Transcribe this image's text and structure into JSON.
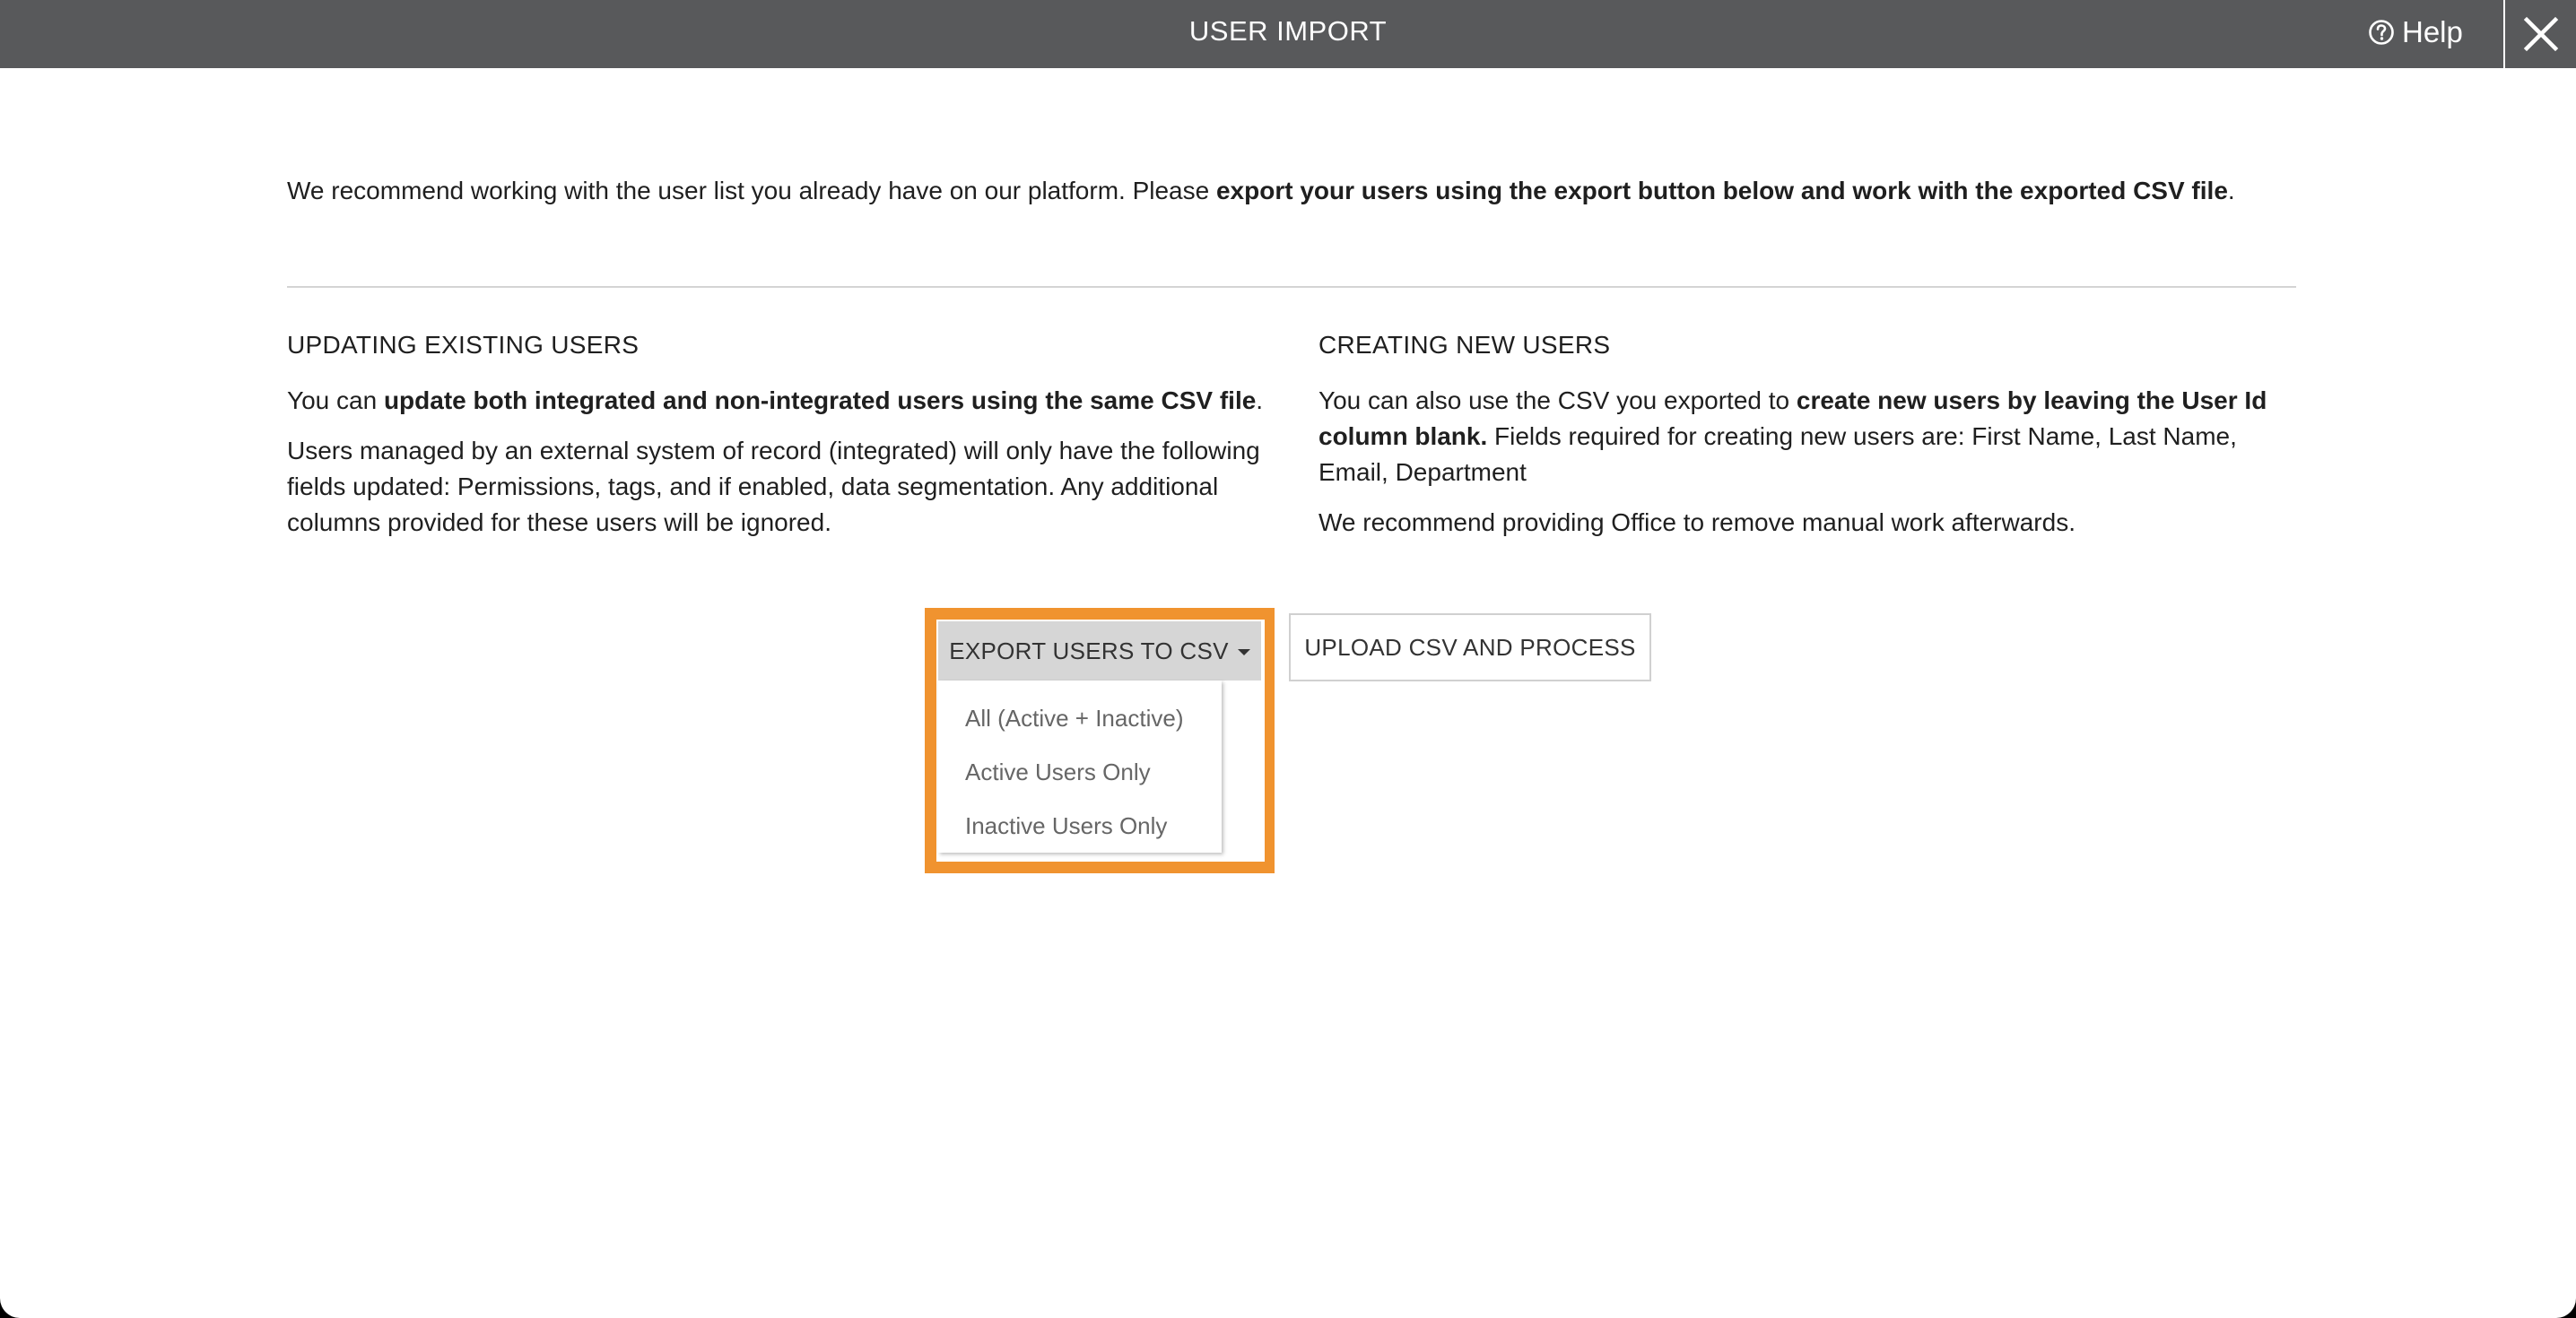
{
  "header": {
    "title": "USER IMPORT",
    "help_label": "Help"
  },
  "intro": {
    "text_before": "We recommend working with the user list you already have on our platform. Please ",
    "bold": "export your users using the export button below and work with the exported CSV file",
    "text_after": "."
  },
  "updating": {
    "heading": "UPDATING EXISTING USERS",
    "p1_before": "You can ",
    "p1_bold": "update both integrated and non-integrated users using the same CSV file",
    "p1_after": ".",
    "p2": "Users managed by an external system of record (integrated) will only have the following fields updated: Permissions, tags, and if enabled, data segmentation. Any additional columns provided for these users will be ignored."
  },
  "creating": {
    "heading": "CREATING NEW USERS",
    "p1_before": "You can also use the CSV you exported to ",
    "p1_bold": "create new users by leaving the User Id column blank.",
    "p1_after": " Fields required for creating new users are: First Name, Last Name, Email, Department",
    "p2": "We recommend providing Office to remove manual work afterwards."
  },
  "actions": {
    "export_label": "EXPORT USERS TO CSV",
    "upload_label": "UPLOAD CSV AND PROCESS",
    "export_menu": [
      "All (Active + Inactive)",
      "Active Users Only",
      "Inactive Users Only"
    ]
  },
  "colors": {
    "header_bg": "#58595b",
    "highlight": "#f0932f",
    "export_button_bg": "#d6d6d6"
  },
  "icons": {
    "help": "question-circle-icon",
    "close": "close-icon",
    "caret": "caret-down-icon"
  }
}
